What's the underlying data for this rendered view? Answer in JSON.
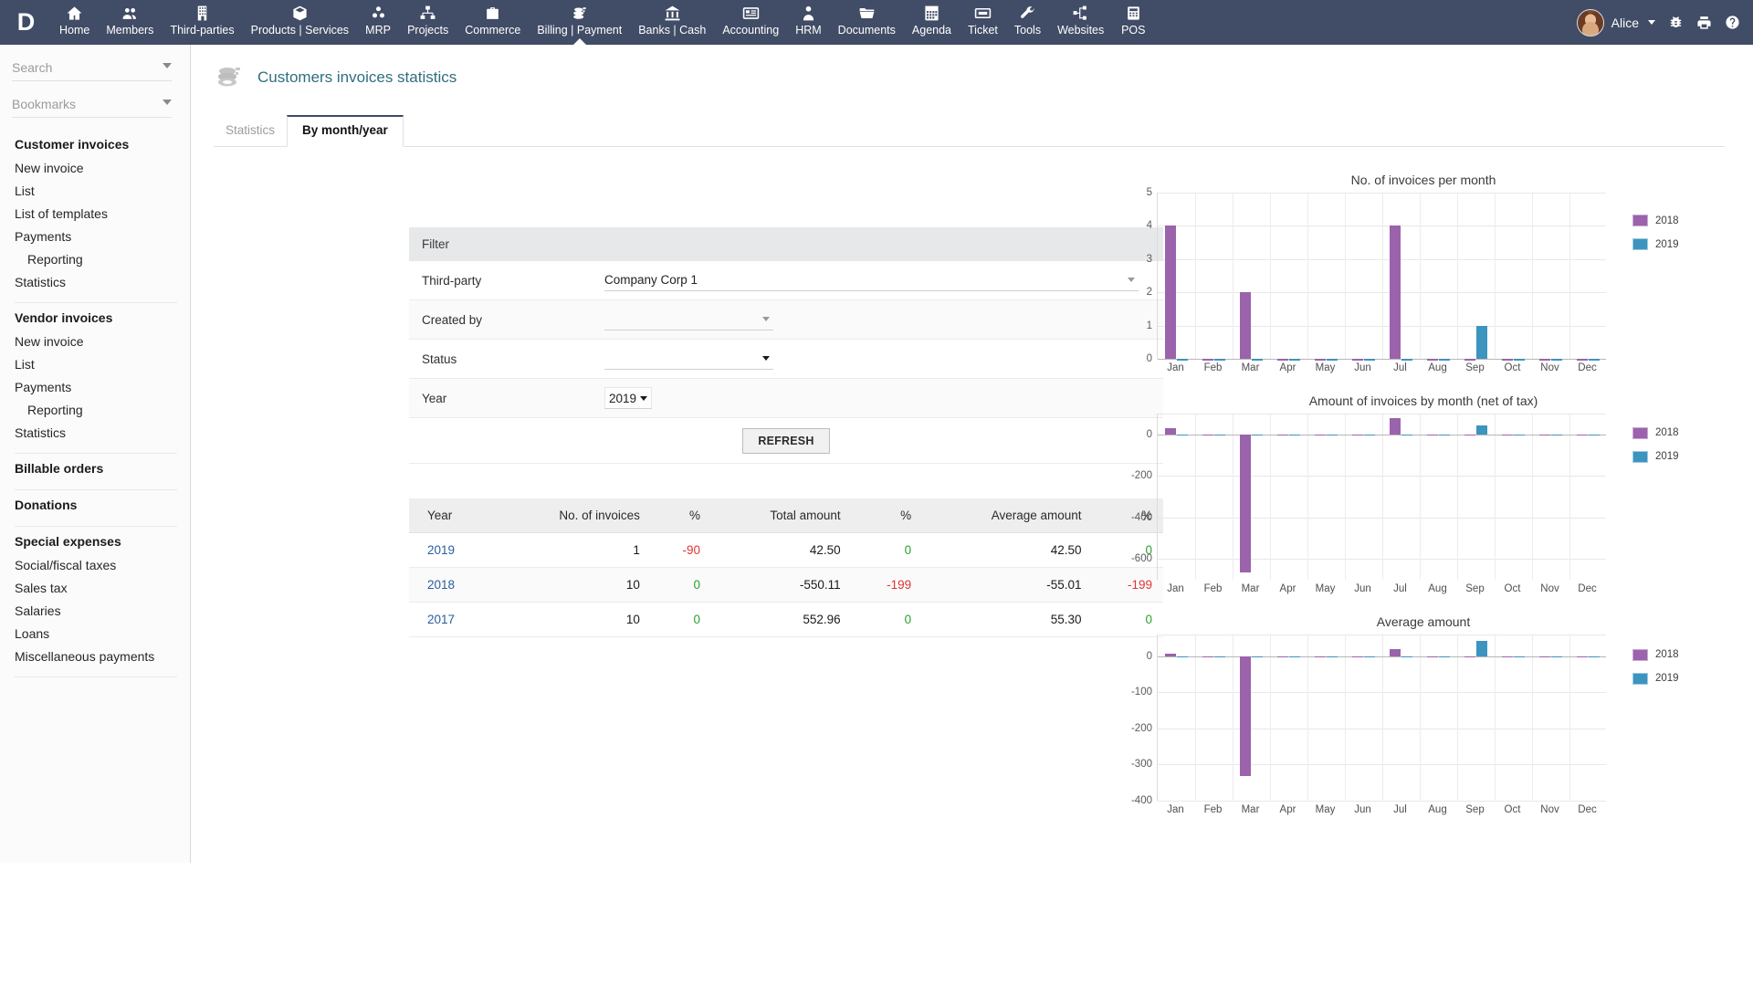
{
  "topnav": {
    "logo": "D",
    "items": [
      {
        "label": "Home",
        "icon": "home-icon"
      },
      {
        "label": "Members",
        "icon": "members-icon"
      },
      {
        "label": "Third-parties",
        "icon": "building-icon"
      },
      {
        "label": "Products | Services",
        "icon": "box-icon"
      },
      {
        "label": "MRP",
        "icon": "mrp-icon"
      },
      {
        "label": "Projects",
        "icon": "projects-icon"
      },
      {
        "label": "Commerce",
        "icon": "briefcase-icon"
      },
      {
        "label": "Billing | Payment",
        "icon": "coins-icon",
        "active": true
      },
      {
        "label": "Banks | Cash",
        "icon": "bank-icon"
      },
      {
        "label": "Accounting",
        "icon": "accounting-icon"
      },
      {
        "label": "HRM",
        "icon": "person-icon"
      },
      {
        "label": "Documents",
        "icon": "folder-icon"
      },
      {
        "label": "Agenda",
        "icon": "calendar-icon"
      },
      {
        "label": "Ticket",
        "icon": "ticket-icon"
      },
      {
        "label": "Tools",
        "icon": "wrench-icon"
      },
      {
        "label": "Websites",
        "icon": "sitemap-icon"
      },
      {
        "label": "POS",
        "icon": "pos-icon"
      }
    ],
    "user": "Alice",
    "right_icons": [
      "bug-icon",
      "print-icon",
      "help-icon"
    ]
  },
  "sidebar": {
    "search_placeholder": "Search",
    "search_value": "",
    "bookmarks_placeholder": "Bookmarks",
    "bookmarks_value": "",
    "groups": [
      {
        "title": "Customer invoices",
        "links": [
          {
            "label": "New invoice"
          },
          {
            "label": "List"
          },
          {
            "label": "List of templates"
          },
          {
            "label": "Payments"
          },
          {
            "label": "Reporting",
            "indent": true
          },
          {
            "label": "Statistics"
          }
        ]
      },
      {
        "title": "Vendor invoices",
        "links": [
          {
            "label": "New invoice"
          },
          {
            "label": "List"
          },
          {
            "label": "Payments"
          },
          {
            "label": "Reporting",
            "indent": true
          },
          {
            "label": "Statistics"
          }
        ]
      },
      {
        "title": "Billable orders",
        "links": []
      },
      {
        "title": "Donations",
        "links": []
      },
      {
        "title": "Special expenses",
        "links": [
          {
            "label": "Social/fiscal taxes"
          },
          {
            "label": "Sales tax"
          },
          {
            "label": "Salaries"
          },
          {
            "label": "Loans"
          },
          {
            "label": "Miscellaneous payments"
          }
        ]
      }
    ]
  },
  "page": {
    "title": "Customers invoices statistics",
    "icon": "coins-icon",
    "tabs": [
      {
        "label": "Statistics",
        "active": false
      },
      {
        "label": "By month/year",
        "active": true
      }
    ]
  },
  "filter": {
    "heading": "Filter",
    "rows": [
      {
        "label": "Third-party",
        "value": "Company Corp 1",
        "placeholder": "",
        "width": "w-full"
      },
      {
        "label": "Created by",
        "value": "",
        "placeholder": "",
        "width": "w-mid"
      },
      {
        "label": "Status",
        "value": "",
        "placeholder": "",
        "width": "w-sm"
      },
      {
        "label": "Year",
        "value": "2019",
        "placeholder": "",
        "width": "w-xs"
      }
    ],
    "refresh_label": "REFRESH"
  },
  "table": {
    "headers": [
      "Year",
      "No. of invoices",
      "%",
      "Total amount",
      "%",
      "Average amount",
      "%"
    ],
    "rows": [
      {
        "year": "2019",
        "count": "1",
        "count_pct": "-90",
        "count_pct_sign": "neg",
        "total": "42.50",
        "total_pct": "0",
        "total_pct_sign": "zero",
        "avg": "42.50",
        "avg_pct": "0",
        "avg_pct_sign": "zero"
      },
      {
        "year": "2018",
        "count": "10",
        "count_pct": "0",
        "count_pct_sign": "zero",
        "total": "-550.11",
        "total_pct": "-199",
        "total_pct_sign": "neg",
        "avg": "-55.01",
        "avg_pct": "-199",
        "avg_pct_sign": "neg"
      },
      {
        "year": "2017",
        "count": "10",
        "count_pct": "0",
        "count_pct_sign": "zero",
        "total": "552.96",
        "total_pct": "0",
        "total_pct_sign": "zero",
        "avg": "55.30",
        "avg_pct": "0",
        "avg_pct_sign": "zero"
      }
    ]
  },
  "colors": {
    "series_2018": "#9a63ab",
    "series_2019": "#3c94bf",
    "navbar": "#414c66",
    "title_text": "#2e6e7e",
    "link": "#2a5d9f",
    "negative": "#e03434",
    "zero": "#2aa12a"
  },
  "chart_data": [
    {
      "type": "bar",
      "title": "No. of invoices per month",
      "xlabel": "",
      "ylabel": "",
      "categories": [
        "Jan",
        "Feb",
        "Mar",
        "Apr",
        "May",
        "Jun",
        "Jul",
        "Aug",
        "Sep",
        "Oct",
        "Nov",
        "Dec"
      ],
      "yticks": [
        0,
        1,
        2,
        3,
        4,
        5
      ],
      "ylim": [
        0,
        5
      ],
      "grid": true,
      "legend_position": "right",
      "series": [
        {
          "name": "2018",
          "color": "#9a63ab",
          "values": [
            4,
            0,
            2,
            0,
            0,
            0,
            4,
            0,
            0,
            0,
            0,
            0
          ]
        },
        {
          "name": "2019",
          "color": "#3c94bf",
          "values": [
            0,
            0,
            0,
            0,
            0,
            0,
            0,
            0,
            1,
            0,
            0,
            0
          ]
        }
      ]
    },
    {
      "type": "bar",
      "title": "Amount of invoices by month (net of tax)",
      "xlabel": "",
      "ylabel": "",
      "categories": [
        "Jan",
        "Feb",
        "Mar",
        "Apr",
        "May",
        "Jun",
        "Jul",
        "Aug",
        "Sep",
        "Oct",
        "Nov",
        "Dec"
      ],
      "yticks": [
        0,
        -200,
        -400,
        -600
      ],
      "ylim": [
        -700,
        100
      ],
      "grid": true,
      "legend_position": "right",
      "series": [
        {
          "name": "2018",
          "color": "#9a63ab",
          "values": [
            32,
            0,
            -665,
            0,
            0,
            0,
            80,
            0,
            0,
            0,
            0,
            0
          ]
        },
        {
          "name": "2019",
          "color": "#3c94bf",
          "values": [
            0,
            0,
            0,
            0,
            0,
            0,
            0,
            0,
            42,
            0,
            0,
            0
          ]
        }
      ]
    },
    {
      "type": "bar",
      "title": "Average amount",
      "xlabel": "",
      "ylabel": "",
      "categories": [
        "Jan",
        "Feb",
        "Mar",
        "Apr",
        "May",
        "Jun",
        "Jul",
        "Aug",
        "Sep",
        "Oct",
        "Nov",
        "Dec"
      ],
      "yticks": [
        0,
        -100,
        -200,
        -300,
        -400
      ],
      "ylim": [
        -400,
        60
      ],
      "grid": true,
      "legend_position": "right",
      "series": [
        {
          "name": "2018",
          "color": "#9a63ab",
          "values": [
            8,
            0,
            -332,
            0,
            0,
            0,
            20,
            0,
            0,
            0,
            0,
            0
          ]
        },
        {
          "name": "2019",
          "color": "#3c94bf",
          "values": [
            0,
            0,
            0,
            0,
            0,
            0,
            0,
            0,
            42,
            0,
            0,
            0
          ]
        }
      ]
    }
  ]
}
